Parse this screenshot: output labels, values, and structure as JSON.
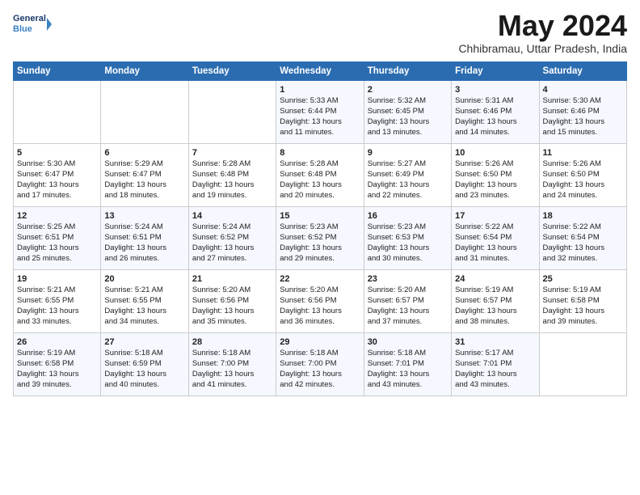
{
  "header": {
    "logo_line1": "General",
    "logo_line2": "Blue",
    "month": "May 2024",
    "location": "Chhibramau, Uttar Pradesh, India"
  },
  "weekdays": [
    "Sunday",
    "Monday",
    "Tuesday",
    "Wednesday",
    "Thursday",
    "Friday",
    "Saturday"
  ],
  "weeks": [
    [
      {
        "day": "",
        "info": ""
      },
      {
        "day": "",
        "info": ""
      },
      {
        "day": "",
        "info": ""
      },
      {
        "day": "1",
        "info": "Sunrise: 5:33 AM\nSunset: 6:44 PM\nDaylight: 13 hours\nand 11 minutes."
      },
      {
        "day": "2",
        "info": "Sunrise: 5:32 AM\nSunset: 6:45 PM\nDaylight: 13 hours\nand 13 minutes."
      },
      {
        "day": "3",
        "info": "Sunrise: 5:31 AM\nSunset: 6:46 PM\nDaylight: 13 hours\nand 14 minutes."
      },
      {
        "day": "4",
        "info": "Sunrise: 5:30 AM\nSunset: 6:46 PM\nDaylight: 13 hours\nand 15 minutes."
      }
    ],
    [
      {
        "day": "5",
        "info": "Sunrise: 5:30 AM\nSunset: 6:47 PM\nDaylight: 13 hours\nand 17 minutes."
      },
      {
        "day": "6",
        "info": "Sunrise: 5:29 AM\nSunset: 6:47 PM\nDaylight: 13 hours\nand 18 minutes."
      },
      {
        "day": "7",
        "info": "Sunrise: 5:28 AM\nSunset: 6:48 PM\nDaylight: 13 hours\nand 19 minutes."
      },
      {
        "day": "8",
        "info": "Sunrise: 5:28 AM\nSunset: 6:48 PM\nDaylight: 13 hours\nand 20 minutes."
      },
      {
        "day": "9",
        "info": "Sunrise: 5:27 AM\nSunset: 6:49 PM\nDaylight: 13 hours\nand 22 minutes."
      },
      {
        "day": "10",
        "info": "Sunrise: 5:26 AM\nSunset: 6:50 PM\nDaylight: 13 hours\nand 23 minutes."
      },
      {
        "day": "11",
        "info": "Sunrise: 5:26 AM\nSunset: 6:50 PM\nDaylight: 13 hours\nand 24 minutes."
      }
    ],
    [
      {
        "day": "12",
        "info": "Sunrise: 5:25 AM\nSunset: 6:51 PM\nDaylight: 13 hours\nand 25 minutes."
      },
      {
        "day": "13",
        "info": "Sunrise: 5:24 AM\nSunset: 6:51 PM\nDaylight: 13 hours\nand 26 minutes."
      },
      {
        "day": "14",
        "info": "Sunrise: 5:24 AM\nSunset: 6:52 PM\nDaylight: 13 hours\nand 27 minutes."
      },
      {
        "day": "15",
        "info": "Sunrise: 5:23 AM\nSunset: 6:52 PM\nDaylight: 13 hours\nand 29 minutes."
      },
      {
        "day": "16",
        "info": "Sunrise: 5:23 AM\nSunset: 6:53 PM\nDaylight: 13 hours\nand 30 minutes."
      },
      {
        "day": "17",
        "info": "Sunrise: 5:22 AM\nSunset: 6:54 PM\nDaylight: 13 hours\nand 31 minutes."
      },
      {
        "day": "18",
        "info": "Sunrise: 5:22 AM\nSunset: 6:54 PM\nDaylight: 13 hours\nand 32 minutes."
      }
    ],
    [
      {
        "day": "19",
        "info": "Sunrise: 5:21 AM\nSunset: 6:55 PM\nDaylight: 13 hours\nand 33 minutes."
      },
      {
        "day": "20",
        "info": "Sunrise: 5:21 AM\nSunset: 6:55 PM\nDaylight: 13 hours\nand 34 minutes."
      },
      {
        "day": "21",
        "info": "Sunrise: 5:20 AM\nSunset: 6:56 PM\nDaylight: 13 hours\nand 35 minutes."
      },
      {
        "day": "22",
        "info": "Sunrise: 5:20 AM\nSunset: 6:56 PM\nDaylight: 13 hours\nand 36 minutes."
      },
      {
        "day": "23",
        "info": "Sunrise: 5:20 AM\nSunset: 6:57 PM\nDaylight: 13 hours\nand 37 minutes."
      },
      {
        "day": "24",
        "info": "Sunrise: 5:19 AM\nSunset: 6:57 PM\nDaylight: 13 hours\nand 38 minutes."
      },
      {
        "day": "25",
        "info": "Sunrise: 5:19 AM\nSunset: 6:58 PM\nDaylight: 13 hours\nand 39 minutes."
      }
    ],
    [
      {
        "day": "26",
        "info": "Sunrise: 5:19 AM\nSunset: 6:58 PM\nDaylight: 13 hours\nand 39 minutes."
      },
      {
        "day": "27",
        "info": "Sunrise: 5:18 AM\nSunset: 6:59 PM\nDaylight: 13 hours\nand 40 minutes."
      },
      {
        "day": "28",
        "info": "Sunrise: 5:18 AM\nSunset: 7:00 PM\nDaylight: 13 hours\nand 41 minutes."
      },
      {
        "day": "29",
        "info": "Sunrise: 5:18 AM\nSunset: 7:00 PM\nDaylight: 13 hours\nand 42 minutes."
      },
      {
        "day": "30",
        "info": "Sunrise: 5:18 AM\nSunset: 7:01 PM\nDaylight: 13 hours\nand 43 minutes."
      },
      {
        "day": "31",
        "info": "Sunrise: 5:17 AM\nSunset: 7:01 PM\nDaylight: 13 hours\nand 43 minutes."
      },
      {
        "day": "",
        "info": ""
      }
    ]
  ]
}
